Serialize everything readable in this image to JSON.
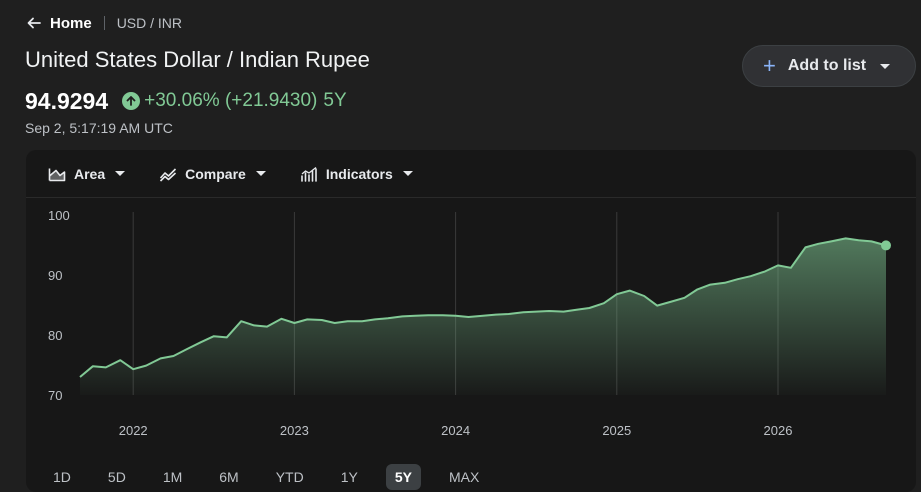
{
  "breadcrumb": {
    "home": "Home",
    "pair": "USD / INR"
  },
  "header": {
    "title": "United States Dollar / Indian Rupee",
    "price": "94.9294",
    "change": "+30.06% (+21.9430)",
    "period": "5Y",
    "timestamp": "Sep 2, 5:17:19 AM UTC"
  },
  "actions": {
    "add_to_list": "Add to list"
  },
  "toolbar": {
    "area": "Area",
    "compare": "Compare",
    "indicators": "Indicators"
  },
  "ranges": [
    "1D",
    "5D",
    "1M",
    "6M",
    "YTD",
    "1Y",
    "5Y",
    "MAX"
  ],
  "active_range": "5Y",
  "colors": {
    "positive": "#81c995",
    "background": "#1f1f1f",
    "card": "#171717"
  },
  "chart_data": {
    "type": "area",
    "xlabel": "",
    "ylabel": "",
    "ylim": [
      70,
      100
    ],
    "y_ticks": [
      70,
      80,
      90,
      100
    ],
    "x_ticks": [
      "2022",
      "2023",
      "2024",
      "2025",
      "2026"
    ],
    "x_tick_positions": [
      2022.0,
      2023.0,
      2024.0,
      2025.0,
      2026.0
    ],
    "grid": "vertical",
    "series": [
      {
        "x": [
          2021.67,
          2021.75,
          2021.83,
          2021.92,
          2022.0,
          2022.08,
          2022.17,
          2022.25,
          2022.33,
          2022.42,
          2022.5,
          2022.58,
          2022.67,
          2022.75,
          2022.83,
          2022.92,
          2023.0,
          2023.08,
          2023.17,
          2023.25,
          2023.33,
          2023.42,
          2023.5,
          2023.58,
          2023.67,
          2023.75,
          2023.83,
          2023.92,
          2024.0,
          2024.08,
          2024.17,
          2024.25,
          2024.33,
          2024.42,
          2024.5,
          2024.58,
          2024.67,
          2024.75,
          2024.83,
          2024.92,
          2025.0,
          2025.08,
          2025.17,
          2025.25,
          2025.33,
          2025.42,
          2025.5,
          2025.58,
          2025.67,
          2025.75,
          2025.83,
          2025.92,
          2026.0,
          2026.08,
          2026.17,
          2026.25,
          2026.33,
          2026.42,
          2026.5,
          2026.58,
          2026.67
        ],
        "values": [
          73.0,
          74.8,
          74.6,
          75.8,
          74.3,
          74.9,
          76.1,
          76.5,
          77.6,
          78.8,
          79.8,
          79.6,
          82.3,
          81.6,
          81.4,
          82.7,
          82.0,
          82.6,
          82.5,
          82.0,
          82.3,
          82.3,
          82.6,
          82.8,
          83.1,
          83.2,
          83.3,
          83.3,
          83.2,
          83.0,
          83.2,
          83.4,
          83.5,
          83.8,
          83.9,
          84.0,
          83.9,
          84.2,
          84.5,
          85.3,
          86.8,
          87.4,
          86.5,
          84.9,
          85.5,
          86.2,
          87.6,
          88.4,
          88.7,
          89.3,
          89.8,
          90.6,
          91.6,
          91.2,
          94.6,
          95.2,
          95.6,
          96.1,
          95.8,
          95.6,
          94.9294
        ]
      }
    ]
  }
}
